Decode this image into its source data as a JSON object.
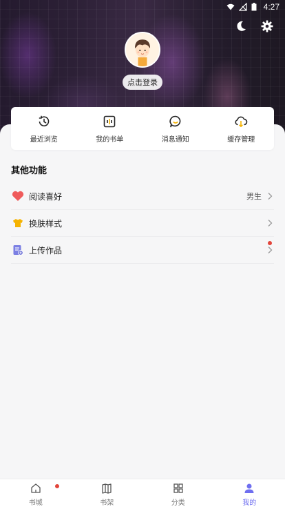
{
  "status_bar": {
    "time": "4:27"
  },
  "profile": {
    "login_label": "点击登录"
  },
  "quick_actions": [
    {
      "label": "最近浏览",
      "icon": "history-icon"
    },
    {
      "label": "我的书单",
      "icon": "booklist-icon"
    },
    {
      "label": "消息通知",
      "icon": "message-icon"
    },
    {
      "label": "缓存管理",
      "icon": "cloud-cache-icon"
    }
  ],
  "other": {
    "title": "其他功能",
    "items": [
      {
        "label": "阅读喜好",
        "value": "男生",
        "icon": "heart-icon"
      },
      {
        "label": "换肤样式",
        "value": "",
        "icon": "shirt-icon"
      },
      {
        "label": "上传作品",
        "value": "",
        "icon": "upload-doc-icon"
      }
    ]
  },
  "bottom_nav": [
    {
      "label": "书城",
      "icon": "home-icon",
      "active": false
    },
    {
      "label": "书架",
      "icon": "bookshelf-icon",
      "active": false
    },
    {
      "label": "分类",
      "icon": "category-icon",
      "active": false
    },
    {
      "label": "我的",
      "icon": "profile-icon",
      "active": true
    }
  ],
  "colors": {
    "accent": "#6f6ff0",
    "badge": "#e2453b",
    "heart": "#ef5b5b",
    "shirt": "#f5b301"
  }
}
